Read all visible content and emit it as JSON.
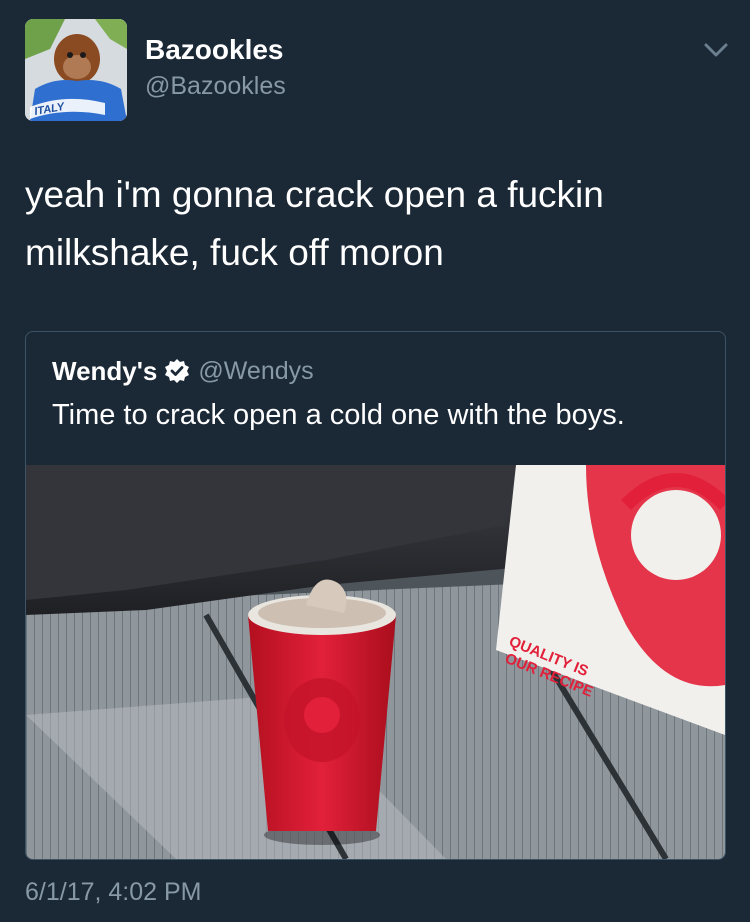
{
  "author": {
    "name": "Bazookles",
    "handle": "@Bazookles",
    "avatar_shirt_text": "ITALY"
  },
  "tweet": {
    "text": "yeah i'm gonna crack open a fuckin milkshake, fuck off moron",
    "timestamp": "6/1/17, 4:02 PM"
  },
  "quoted": {
    "name": "Wendy's",
    "handle": "@Wendys",
    "verified": true,
    "text": "Time to crack open a cold one with the boys.",
    "photo_bag_text": [
      "QUALITY IS",
      "OUR RECIPE"
    ]
  },
  "colors": {
    "background": "#1b2836",
    "secondary_text": "#8899a6",
    "border": "#3d5466",
    "wendys_red": "#e2203a"
  },
  "icons": {
    "more": "chevron-down-icon",
    "verified": "verified-badge-icon"
  }
}
